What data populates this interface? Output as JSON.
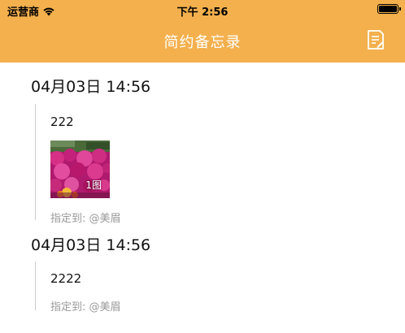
{
  "status_bar": {
    "carrier": "运营商",
    "time": "下午 2:56"
  },
  "header": {
    "title": "简约备忘录",
    "background": "#F3B04D"
  },
  "notes": [
    {
      "date": "04月03日 14:56",
      "text": "222",
      "image_count_label": "1图",
      "assigned": "指定到: @美眉"
    },
    {
      "date": "04月03日 14:56",
      "text": "2222",
      "assigned": "指定到: @美眉"
    }
  ],
  "icons": {
    "wifi": "wifi-icon",
    "battery": "battery-icon",
    "compose": "note-edit-icon"
  }
}
